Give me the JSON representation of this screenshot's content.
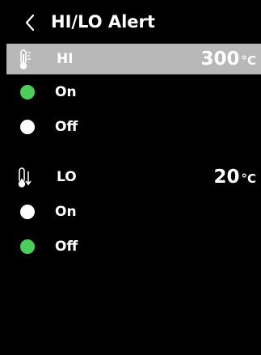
{
  "header": {
    "title": "HI/LO Alert",
    "back_icon": "chevron-left-icon"
  },
  "colors": {
    "background": "#000000",
    "highlight_row": "#b8b8b8",
    "radio_selected": "#4ccf5a",
    "radio_unselected": "#ffffff",
    "text": "#ffffff"
  },
  "hi": {
    "icon": "thermometer-high-icon",
    "label": "HI",
    "value": "300",
    "unit": "°C",
    "options": [
      {
        "label": "On",
        "selected": true
      },
      {
        "label": "Off",
        "selected": false
      }
    ]
  },
  "lo": {
    "icon": "thermometer-low-icon",
    "label": "LO",
    "value": "20",
    "unit": "°C",
    "options": [
      {
        "label": "On",
        "selected": false
      },
      {
        "label": "Off",
        "selected": true
      }
    ]
  }
}
